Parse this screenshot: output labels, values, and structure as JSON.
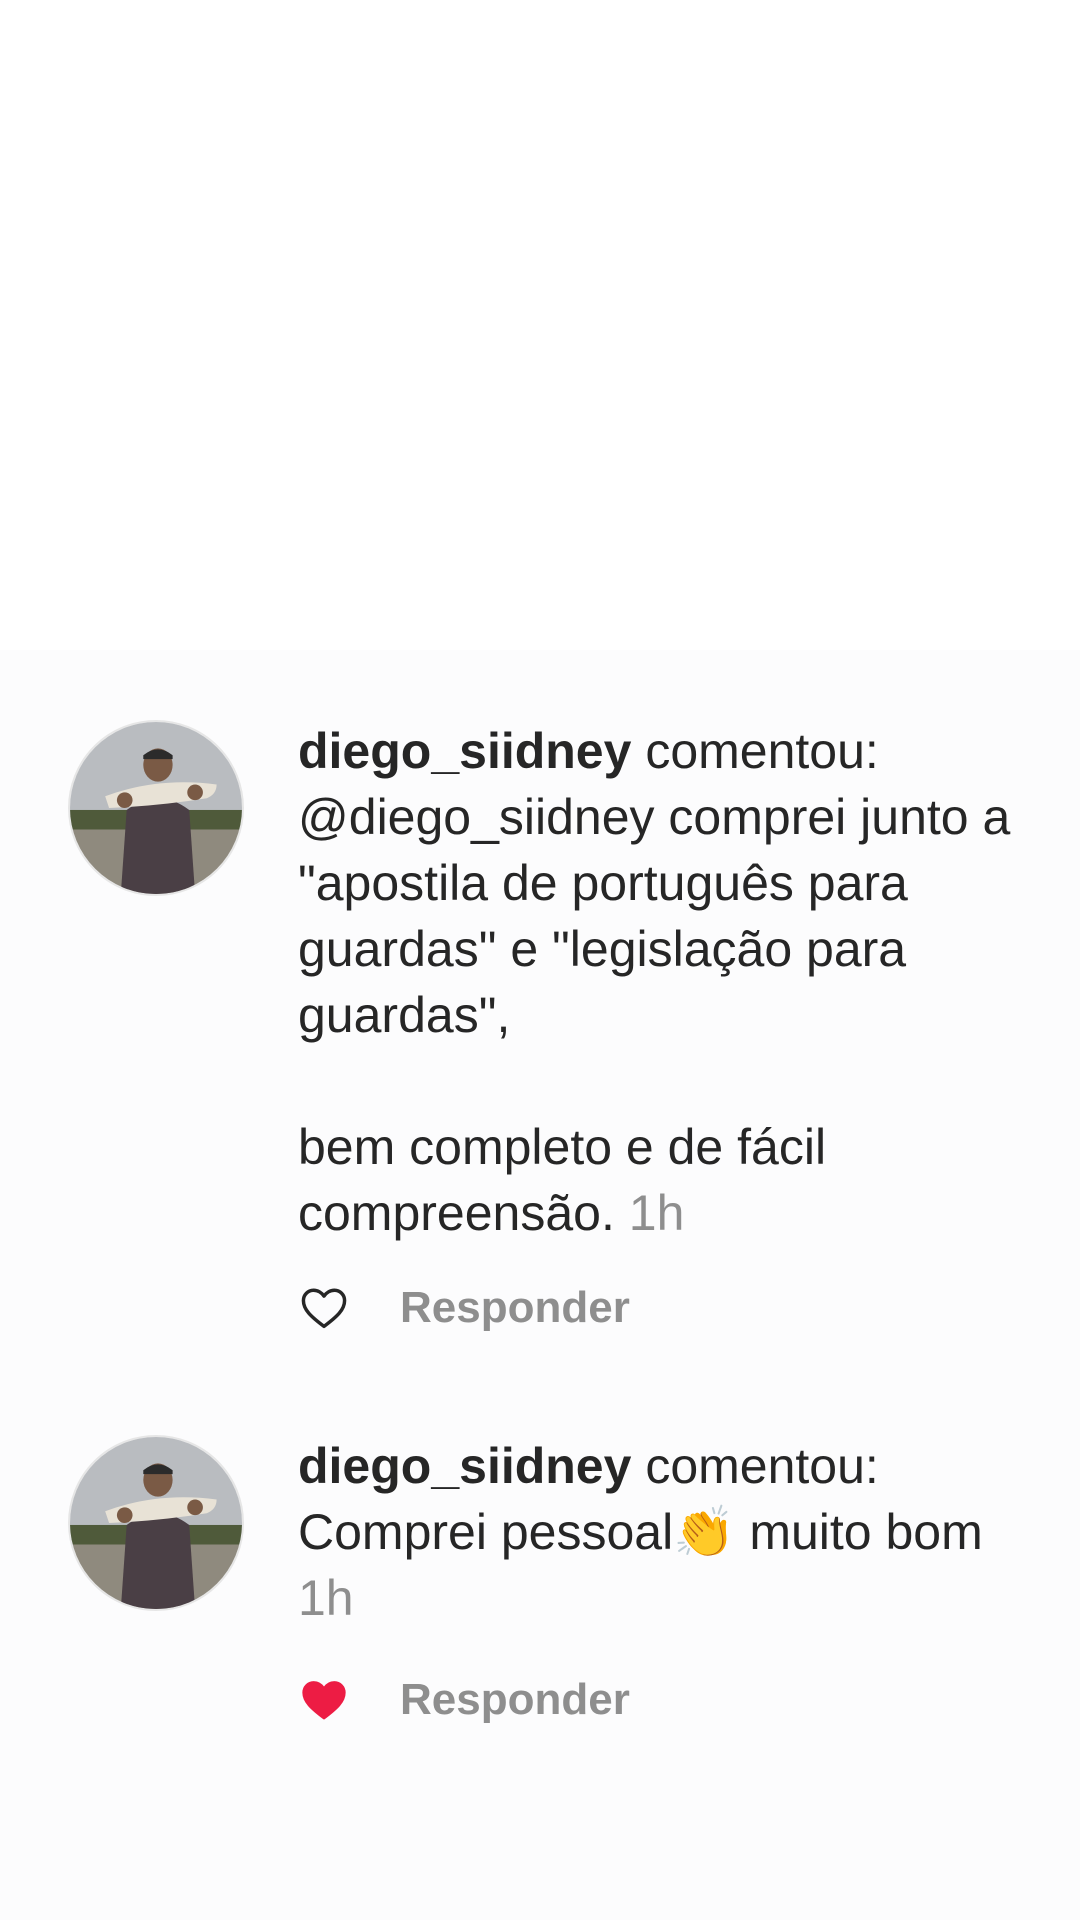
{
  "comments": [
    {
      "username": "diego_siidney",
      "verb": "comentou:",
      "text": "@diego_siidney comprei junto a \"apostila de português para guardas\" e \"legislação para guardas\",\n\nbem completo e de fácil compreensão.",
      "time": "1h",
      "reply_label": "Responder",
      "liked": false
    },
    {
      "username": "diego_siidney",
      "verb": "comentou:",
      "text_before_emoji": "Comprei pessoal",
      "emoji": "👏",
      "text_after_emoji": " muito bom",
      "emoji_icon": "clapping-hands-emoji",
      "time": "1h",
      "reply_label": "Responder",
      "liked": true
    }
  ],
  "colors": {
    "text": "#262626",
    "muted": "#8e8e8e",
    "like_red": "#ed1c44",
    "panel_bg": "#fcfcfd"
  }
}
